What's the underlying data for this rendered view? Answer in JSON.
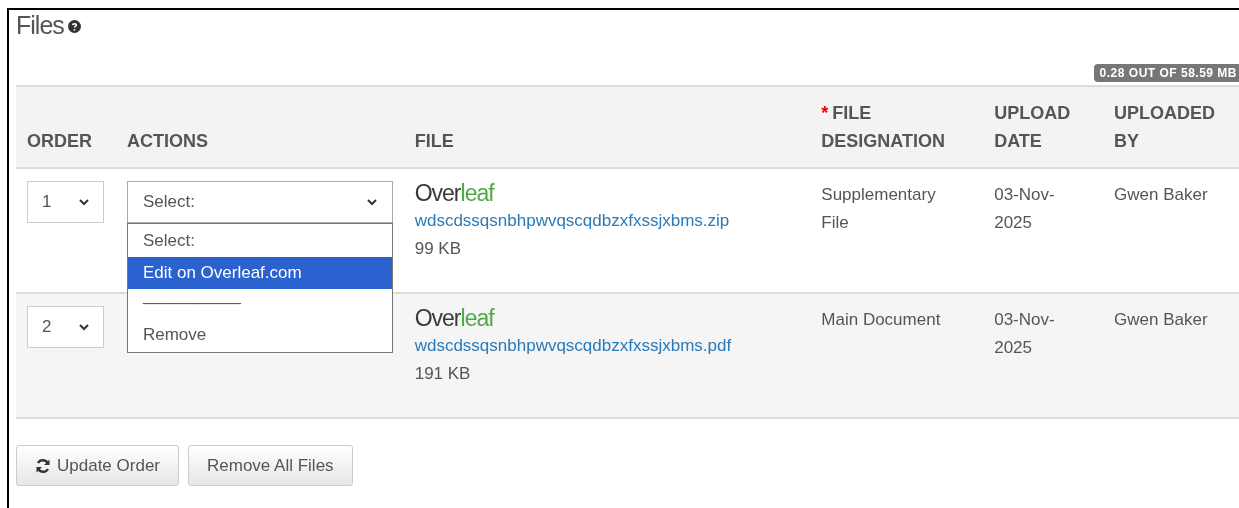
{
  "title": "Files",
  "storage": "0.28 OUT OF 58.59 MB",
  "columns": [
    {
      "label": "ORDER",
      "required": false
    },
    {
      "label": "ACTIONS",
      "required": false
    },
    {
      "label": "FILE",
      "required": false
    },
    {
      "label": "FILE DESIGNATION",
      "required": true,
      "required_mark": "*"
    },
    {
      "label": "UPLOAD DATE",
      "required": false
    },
    {
      "label": "UPLOADED BY",
      "required": false
    }
  ],
  "rows": [
    {
      "order": "1",
      "action": "Select:",
      "logo_parts": [
        "Over",
        "leaf"
      ],
      "file": "wdscdssqsnbhpwvqscqdbzxfxssjxbms.zip",
      "size": "99 KB",
      "designation": "Supplementary File",
      "date": "03-Nov-2025",
      "by": "Gwen Baker",
      "menu_open": true
    },
    {
      "order": "2",
      "logo_parts": [
        "Over",
        "leaf"
      ],
      "file": "wdscdssqsnbhpwvqscqdbzxfxssjxbms.pdf",
      "size": "191 KB",
      "designation": "Main Document",
      "date": "03-Nov-2025",
      "by": "Gwen Baker",
      "menu_open": false
    }
  ],
  "menu": [
    {
      "label": "Select:",
      "kind": "option",
      "selected": false
    },
    {
      "label": "Edit on Overleaf.com",
      "kind": "option",
      "selected": true
    },
    {
      "label": "___________",
      "kind": "separator",
      "selected": false
    },
    {
      "label": "Remove",
      "kind": "option",
      "selected": false
    }
  ],
  "buttons": [
    {
      "label": "Update Order",
      "kind": "refresh"
    },
    {
      "label": "Remove All Files",
      "kind": "plain"
    }
  ]
}
